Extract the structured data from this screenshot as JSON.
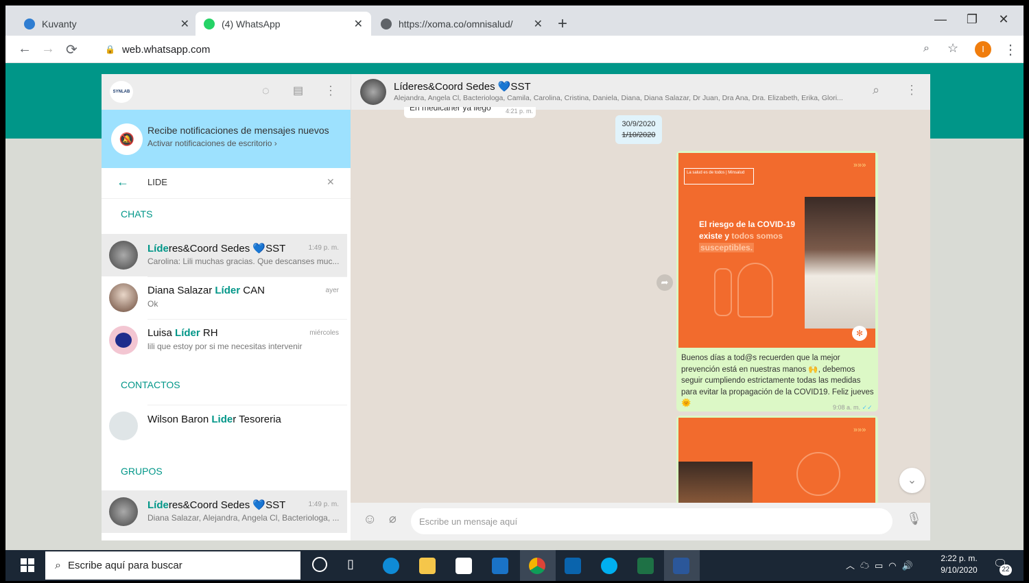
{
  "browser": {
    "tabs": [
      {
        "title": "Kuvanty",
        "icon": "kuvanty-icon",
        "active": false
      },
      {
        "title": "(4) WhatsApp",
        "icon": "whatsapp-icon",
        "active": true
      },
      {
        "title": "https://xoma.co/omnisalud/",
        "icon": "globe-icon",
        "active": false
      }
    ],
    "url": "web.whatsapp.com",
    "profile_initial": "I"
  },
  "left": {
    "header_logo": "SYNLAB",
    "notification": {
      "title": "Recibe notificaciones de mensajes nuevos",
      "action": "Activar notificaciones de escritorio ›"
    },
    "search_value": "LIDE",
    "sections": {
      "chats": "CHATS",
      "contacts": "CONTACTOS",
      "groups": "GRUPOS"
    },
    "chats": [
      {
        "name_pre": "",
        "name_hl": "Líde",
        "name_post": "res&Coord Sedes 💙SST",
        "time": "1:49 p. m.",
        "msg": "Carolina: Lili muchas gracias. Que descanses muc..."
      },
      {
        "name_pre": "Diana Salazar ",
        "name_hl": "Líder",
        "name_post": " CAN",
        "time": "ayer",
        "msg": "Ok"
      },
      {
        "name_pre": "Luisa ",
        "name_hl": "Líder",
        "name_post": " RH",
        "time": "miércoles",
        "msg": "lili que estoy por si me necesitas intervenir"
      }
    ],
    "contacts": [
      {
        "name_pre": "Wilson Baron ",
        "name_hl": "Lide",
        "name_post": "r Tesoreria"
      }
    ],
    "groups": [
      {
        "name_pre": "",
        "name_hl": "Líde",
        "name_post": "res&Coord Sedes 💙SST",
        "time": "1:49 p. m.",
        "msg": "Diana Salazar, Alejandra, Angela Cl, Bacteriologa, ..."
      }
    ]
  },
  "chat": {
    "title": "Líderes&Coord Sedes 💙SST",
    "members": "Alejandra, Angela Cl, Bacteriologa, Camila, Carolina, Cristina, Daniela, Diana, Diana Salazar, Dr Juan, Dra Ana, Dra. Elizabeth, Erika, Glori...",
    "prev_msg_partial": "En medicaner ya llego",
    "prev_msg_time": "4:21 p. m.",
    "date_chip_1": "30/9/2020",
    "date_chip_2": "1/10/2020",
    "image1": {
      "header_left": "La salud es de todos",
      "header_right": "Minsalud",
      "arrows": "»»»",
      "line1": "El riesgo de la COVID-19",
      "line2a": "existe y ",
      "line2b": "todos somos",
      "line3": "susceptibles."
    },
    "caption": "Buenos días a tod@s recuerden que la mejor prevención está en nuestras manos 🙌, debemos seguir cumpliendo estrictamente todas las medidas para evitar la propagación de la COVID19. Feliz jueves 🌞",
    "caption_time": "9:08 a. m.",
    "image2_arrows": "»»»",
    "input_placeholder": "Escribe un mensaje aquí"
  },
  "taskbar": {
    "search_placeholder": "Escribe aquí para buscar",
    "time": "2:22 p. m.",
    "date": "9/10/2020",
    "notif_count": "22"
  },
  "colors": {
    "teal": "#009688",
    "highlight_bubble": "#dcf8c6",
    "orange": "#f26b2d"
  }
}
